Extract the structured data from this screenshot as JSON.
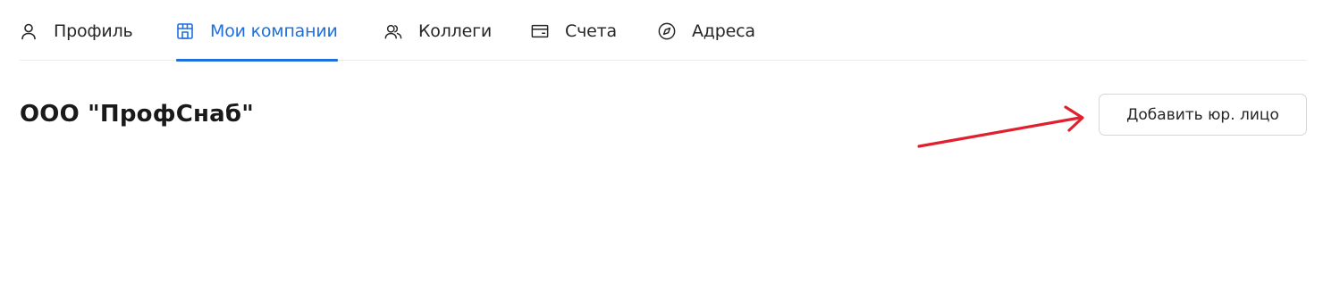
{
  "tabs": [
    {
      "key": "profile",
      "label": "Профиль",
      "icon": "user-icon",
      "active": false
    },
    {
      "key": "companies",
      "label": "Мои компании",
      "icon": "store-icon",
      "active": true
    },
    {
      "key": "colleagues",
      "label": "Коллеги",
      "icon": "users-icon",
      "active": false
    },
    {
      "key": "accounts",
      "label": "Счета",
      "icon": "wallet-icon",
      "active": false
    },
    {
      "key": "addresses",
      "label": "Адреса",
      "icon": "compass-icon",
      "active": false
    }
  ],
  "company": {
    "name": "ООО \"ПрофСнаб\"",
    "add_button_label": "Добавить юр. лицо"
  },
  "colors": {
    "accent": "#1e6fe0",
    "annotation_arrow": "#e0202e",
    "text": "#262626",
    "border": "#d6d6d6"
  }
}
